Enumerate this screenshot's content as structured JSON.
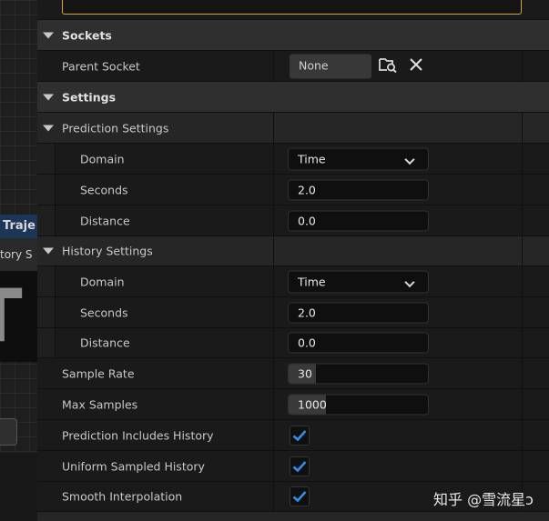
{
  "background": {
    "tab_label": "Traje",
    "sub_label": "tory S",
    "big_glyph": "T"
  },
  "sockets": {
    "header": "Sockets",
    "parent_socket_label": "Parent Socket",
    "parent_socket_value": "None"
  },
  "settings": {
    "header": "Settings",
    "prediction": {
      "header": "Prediction Settings",
      "domain_label": "Domain",
      "domain_value": "Time",
      "seconds_label": "Seconds",
      "seconds_value": "2.0",
      "distance_label": "Distance",
      "distance_value": "0.0"
    },
    "history": {
      "header": "History Settings",
      "domain_label": "Domain",
      "domain_value": "Time",
      "seconds_label": "Seconds",
      "seconds_value": "2.0",
      "distance_label": "Distance",
      "distance_value": "0.0"
    },
    "sample_rate_label": "Sample Rate",
    "sample_rate_value": "30",
    "max_samples_label": "Max Samples",
    "max_samples_value": "1000",
    "prediction_includes_history_label": "Prediction Includes History",
    "prediction_includes_history": true,
    "uniform_sampled_history_label": "Uniform Sampled History",
    "uniform_sampled_history": true,
    "smooth_interpolation_label": "Smooth Interpolation",
    "smooth_interpolation": true
  },
  "watermark": "知乎 @雪流星ↄ",
  "colors": {
    "accent_check": "#2f8fe6",
    "top_box_border": "#d6a726",
    "tab_blue": "#1d3557"
  }
}
